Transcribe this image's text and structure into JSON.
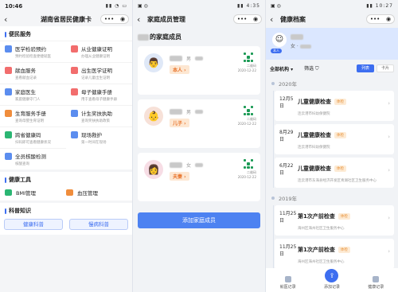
{
  "screen1": {
    "time": "10:46",
    "title": "湖南省居民健康卡",
    "services_heading": "便民服务",
    "services": [
      {
        "label": "医学检验预约",
        "sub": "预约检验检查便捷就医",
        "icon": "test-icon",
        "color": "#5b8def"
      },
      {
        "label": "从业健康证明",
        "sub": "办理从业健康证明",
        "icon": "certificate-icon",
        "color": "#f26d6d"
      },
      {
        "label": "献血服务",
        "sub": "查看献血记录",
        "icon": "blood-icon",
        "color": "#f26d6d"
      },
      {
        "label": "出生医学证明",
        "sub": "记录儿童出生证明",
        "icon": "birth-icon",
        "color": "#f26d6d"
      },
      {
        "label": "家庭医生",
        "sub": "家庭健康守门人",
        "icon": "doctor-icon",
        "color": "#5b8def"
      },
      {
        "label": "母子健康手册",
        "sub": "用于查看母子健康手册",
        "icon": "mother-icon",
        "color": "#f26d6d"
      },
      {
        "label": "生育服务手册",
        "sub": "查询母婴生育证明",
        "icon": "fertility-icon",
        "color": "#f08d3c"
      },
      {
        "label": "计生奖扶执助",
        "sub": "查询奖扶执助政策",
        "icon": "family-plan-icon",
        "color": "#5b8def"
      },
      {
        "label": "跨省健康码",
        "sub": "扫码即可查看健康状况",
        "icon": "qr-icon",
        "color": "#2bb673"
      },
      {
        "label": "现场救护",
        "sub": "第一时间在现场",
        "icon": "rescue-icon",
        "color": "#5b8def"
      },
      {
        "label": "全员核酸检测",
        "sub": "核酸查询",
        "icon": "test-tube-icon",
        "color": "#5b8def"
      }
    ],
    "tools_heading": "健康工具",
    "tools": [
      {
        "label": "BMI管理",
        "icon": "bmi-icon",
        "color": "#2bb673"
      },
      {
        "label": "血压管理",
        "icon": "blood-pressure-icon",
        "color": "#f08d3c"
      }
    ],
    "science_heading": "科普知识",
    "science": [
      "健康科普",
      "慢病科普"
    ]
  },
  "screen2": {
    "time": "4:35",
    "title": "家庭成员管理",
    "heading_suffix": "的家庭成员",
    "members": [
      {
        "gender": "男",
        "relation": "本人",
        "updated": "2020-12-22",
        "avatar": "male-avatar-icon",
        "bg": "#dfe8f7"
      },
      {
        "gender": "男",
        "relation": "儿子",
        "updated": "2020-12-22",
        "avatar": "child-avatar-icon",
        "bg": "#f7e1d8"
      },
      {
        "gender": "女",
        "relation": "夫妻",
        "updated": "2020-12-22",
        "avatar": "female-avatar-icon",
        "bg": "#f7dde5"
      }
    ],
    "qr_label": "二维码",
    "add_button": "添加家庭成员"
  },
  "screen3": {
    "time": "10:27",
    "title": "健康档案",
    "profile_tag": "本人",
    "profile_gender": "女",
    "org_filter": "全部机构",
    "filter": "筛选",
    "seg_list": "列表",
    "seg_card": "卡片",
    "years": [
      {
        "year": "2020年",
        "records": [
          {
            "date": "12月5日",
            "name": "儿童健康检查",
            "chip": "体检",
            "sub": "连云港市妇幼保健院"
          },
          {
            "date": "8月29日",
            "name": "儿童健康检查",
            "chip": "体检",
            "sub": "连云港市妇幼保健院"
          },
          {
            "date": "6月22日",
            "name": "儿童健康检查",
            "chip": "体检",
            "sub": "连云港市东海县经济开发区青湖社区卫生服务中心"
          }
        ]
      },
      {
        "year": "2019年",
        "records": [
          {
            "date": "11月25日",
            "name": "第1次产前检查",
            "chip": "体检",
            "sub": "海州区海州社区卫生服务中心"
          },
          {
            "date": "11月25日",
            "name": "第1次产前检查",
            "chip": "体检",
            "sub": "海州区海州社区卫生服务中心"
          }
        ]
      }
    ],
    "tabs": [
      "就医记录",
      "添加记录",
      "健康记录"
    ]
  }
}
